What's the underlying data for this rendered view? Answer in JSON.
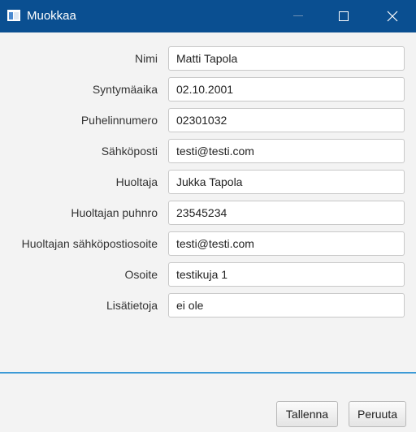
{
  "window": {
    "title": "Muokkaa"
  },
  "form": {
    "fields": [
      {
        "label": "Nimi",
        "value": "Matti Tapola"
      },
      {
        "label": "Syntymäaika",
        "value": "02.10.2001"
      },
      {
        "label": "Puhelinnumero",
        "value": "02301032"
      },
      {
        "label": "Sähköposti",
        "value": "testi@testi.com"
      },
      {
        "label": "Huoltaja",
        "value": "Jukka Tapola"
      },
      {
        "label": "Huoltajan puhnro",
        "value": "23545234"
      },
      {
        "label": "Huoltajan sähköpostiosoite",
        "value": "testi@testi.com"
      },
      {
        "label": "Osoite",
        "value": "testikuja 1"
      },
      {
        "label": "Lisätietoja",
        "value": "ei ole"
      }
    ]
  },
  "buttons": {
    "save": "Tallenna",
    "cancel": "Peruuta"
  },
  "colors": {
    "titlebar": "#0a4f91",
    "divider": "#3c9ad6"
  },
  "icons": {
    "app": "window-icon",
    "minimize": "minimize-icon",
    "maximize": "maximize-icon",
    "close": "close-icon"
  }
}
